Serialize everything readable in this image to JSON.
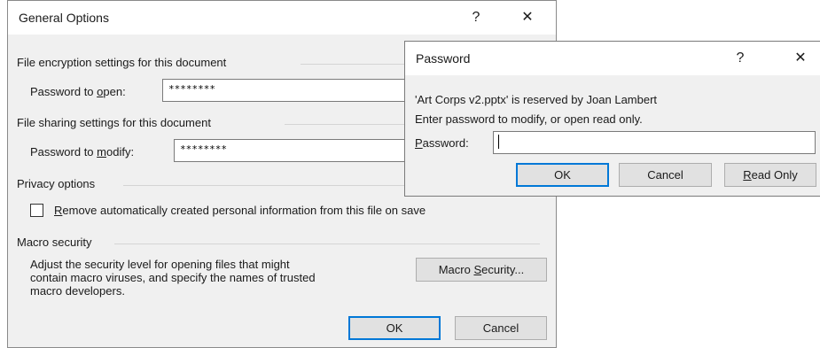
{
  "general": {
    "title": "General Options",
    "help": "?",
    "close": "✕",
    "enc_section": "File encryption settings for this document",
    "open_label_pre": "Password to ",
    "open_label_key": "o",
    "open_label_post": "pen:",
    "open_value": "********",
    "share_section": "File sharing settings for this document",
    "modify_label_pre": "Password to ",
    "modify_label_key": "m",
    "modify_label_post": "odify:",
    "modify_value": "********",
    "privacy_section": "Privacy options",
    "privacy_checkbox_key": "R",
    "privacy_checkbox_rest": "emove automatically created personal information from this file on save",
    "privacy_checked": false,
    "macro_section": "Macro security",
    "macro_desc": [
      "Adjust the security level for opening files that might",
      "contain macro viruses, and specify the names of trusted",
      "macro developers."
    ],
    "macro_btn_pre": "Macro ",
    "macro_btn_key": "S",
    "macro_btn_post": "ecurity...",
    "ok": "OK",
    "cancel": "Cancel"
  },
  "password": {
    "title": "Password",
    "help": "?",
    "close": "✕",
    "line1": "'Art Corps v2.pptx' is reserved by Joan Lambert",
    "line2": "Enter password to modify, or open read only.",
    "label_key": "P",
    "label_rest": "assword:",
    "value": "",
    "ok": "OK",
    "cancel": "Cancel",
    "readonly_key": "R",
    "readonly_rest": "ead Only"
  }
}
